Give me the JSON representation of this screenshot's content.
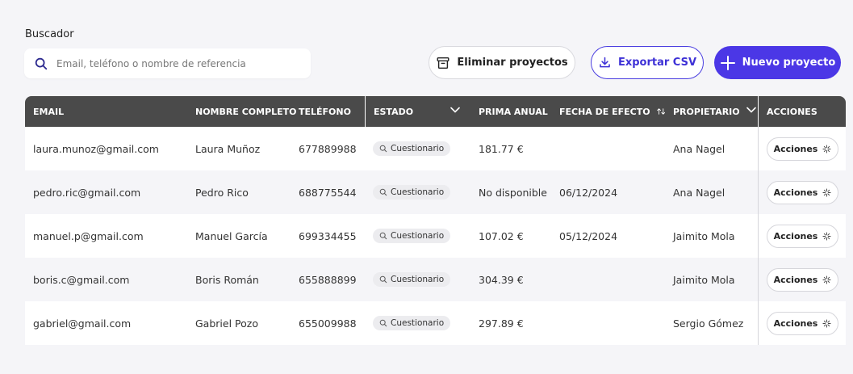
{
  "search": {
    "label": "Buscador",
    "placeholder": "Email, teléfono o nombre de referencia",
    "value": ""
  },
  "toolbar": {
    "delete_label": "Eliminar proyectos",
    "export_label": "Exportar CSV",
    "new_label": "Nuevo proyecto"
  },
  "colors": {
    "accent": "#4b37e6",
    "header_bg": "#4a4a4a"
  },
  "table": {
    "headers": {
      "email": "EMAIL",
      "name": "NOMBRE COMPLETO",
      "phone": "TELÉFONO",
      "status": "ESTADO",
      "premium": "PRIMA ANUAL",
      "date": "FECHA DE EFECTO",
      "owner": "PROPIETARIO",
      "actions": "ACCIONES"
    },
    "rows": [
      {
        "email": "laura.munoz@gmail.com",
        "name": "Laura Muñoz",
        "phone": "677889988",
        "status": "Cuestionario",
        "premium": "181.77 €",
        "date": "",
        "owner": "Ana Nagel",
        "action": "Acciones"
      },
      {
        "email": "pedro.ric@gmail.com",
        "name": "Pedro Rico",
        "phone": "688775544",
        "status": "Cuestionario",
        "premium": "No disponible",
        "date": "06/12/2024",
        "owner": "Ana Nagel",
        "action": "Acciones"
      },
      {
        "email": "manuel.p@gmail.com",
        "name": "Manuel García",
        "phone": "699334455",
        "status": "Cuestionario",
        "premium": "107.02 €",
        "date": "05/12/2024",
        "owner": "Jaimito Mola",
        "action": "Acciones"
      },
      {
        "email": "boris.c@gmail.com",
        "name": "Boris Román",
        "phone": "655888899",
        "status": "Cuestionario",
        "premium": "304.39 €",
        "date": "",
        "owner": "Jaimito Mola",
        "action": "Acciones"
      },
      {
        "email": "gabriel@gmail.com",
        "name": "Gabriel Pozo",
        "phone": "655009988",
        "status": "Cuestionario",
        "premium": "297.89 €",
        "date": "",
        "owner": "Sergio Gómez",
        "action": "Acciones"
      }
    ]
  }
}
